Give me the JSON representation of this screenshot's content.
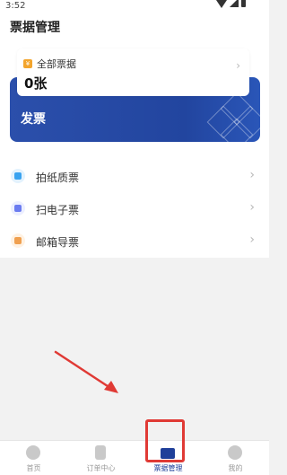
{
  "status_bar": {
    "time": "3:52"
  },
  "header": {
    "title": "票据管理"
  },
  "invoice_card": {
    "label": "全部票据",
    "count": "0张"
  },
  "banner": {
    "label": "发票"
  },
  "menu": {
    "items": [
      {
        "label": "拍纸质票",
        "icon": "camera-icon",
        "color": "#3aa3f0"
      },
      {
        "label": "扫电子票",
        "icon": "scan-icon",
        "color": "#6b7cf0"
      },
      {
        "label": "邮箱导票",
        "icon": "mail-icon",
        "color": "#f0a050"
      }
    ]
  },
  "bottom_nav": {
    "items": [
      {
        "label": "首页"
      },
      {
        "label": "订单中心"
      },
      {
        "label": "票据管理"
      },
      {
        "label": "我的"
      }
    ]
  },
  "colors": {
    "accent": "#1f3f99",
    "highlight": "#e03a35"
  }
}
